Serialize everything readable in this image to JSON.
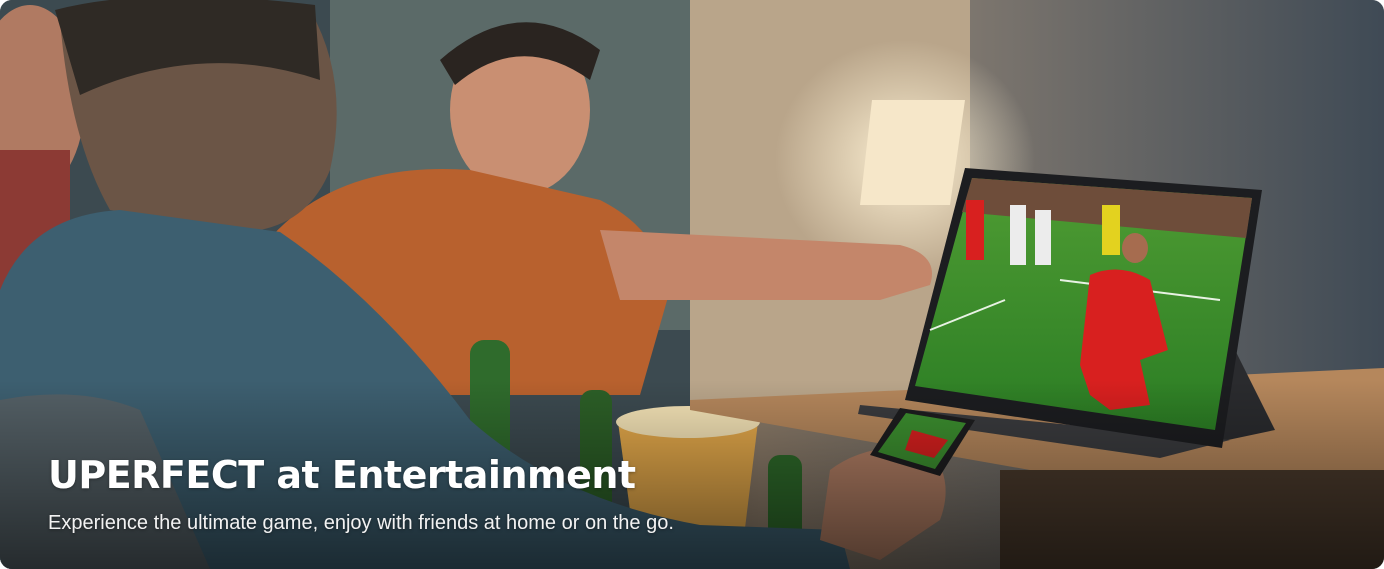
{
  "banner": {
    "headline": "UPERFECT at Entertainment",
    "subtext": "Experience the ultimate game, enjoy with friends at home or on the go."
  },
  "colors": {
    "headline_text": "#ffffff",
    "pitch_green": "#2f8f2a",
    "player_kit": "#d8201f",
    "shirt_orange": "#b8612e",
    "denim_shirt": "#3d5f70",
    "table_wood": "#b5875c"
  }
}
